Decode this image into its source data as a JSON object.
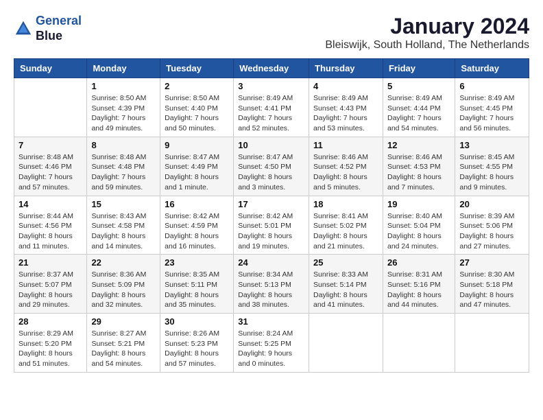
{
  "header": {
    "logo_line1": "General",
    "logo_line2": "Blue",
    "month": "January 2024",
    "location": "Bleiswijk, South Holland, The Netherlands"
  },
  "weekdays": [
    "Sunday",
    "Monday",
    "Tuesday",
    "Wednesday",
    "Thursday",
    "Friday",
    "Saturday"
  ],
  "weeks": [
    [
      {
        "day": "",
        "sunrise": "",
        "sunset": "",
        "daylight": ""
      },
      {
        "day": "1",
        "sunrise": "Sunrise: 8:50 AM",
        "sunset": "Sunset: 4:39 PM",
        "daylight": "Daylight: 7 hours and 49 minutes."
      },
      {
        "day": "2",
        "sunrise": "Sunrise: 8:50 AM",
        "sunset": "Sunset: 4:40 PM",
        "daylight": "Daylight: 7 hours and 50 minutes."
      },
      {
        "day": "3",
        "sunrise": "Sunrise: 8:49 AM",
        "sunset": "Sunset: 4:41 PM",
        "daylight": "Daylight: 7 hours and 52 minutes."
      },
      {
        "day": "4",
        "sunrise": "Sunrise: 8:49 AM",
        "sunset": "Sunset: 4:43 PM",
        "daylight": "Daylight: 7 hours and 53 minutes."
      },
      {
        "day": "5",
        "sunrise": "Sunrise: 8:49 AM",
        "sunset": "Sunset: 4:44 PM",
        "daylight": "Daylight: 7 hours and 54 minutes."
      },
      {
        "day": "6",
        "sunrise": "Sunrise: 8:49 AM",
        "sunset": "Sunset: 4:45 PM",
        "daylight": "Daylight: 7 hours and 56 minutes."
      }
    ],
    [
      {
        "day": "7",
        "sunrise": "Sunrise: 8:48 AM",
        "sunset": "Sunset: 4:46 PM",
        "daylight": "Daylight: 7 hours and 57 minutes."
      },
      {
        "day": "8",
        "sunrise": "Sunrise: 8:48 AM",
        "sunset": "Sunset: 4:48 PM",
        "daylight": "Daylight: 7 hours and 59 minutes."
      },
      {
        "day": "9",
        "sunrise": "Sunrise: 8:47 AM",
        "sunset": "Sunset: 4:49 PM",
        "daylight": "Daylight: 8 hours and 1 minute."
      },
      {
        "day": "10",
        "sunrise": "Sunrise: 8:47 AM",
        "sunset": "Sunset: 4:50 PM",
        "daylight": "Daylight: 8 hours and 3 minutes."
      },
      {
        "day": "11",
        "sunrise": "Sunrise: 8:46 AM",
        "sunset": "Sunset: 4:52 PM",
        "daylight": "Daylight: 8 hours and 5 minutes."
      },
      {
        "day": "12",
        "sunrise": "Sunrise: 8:46 AM",
        "sunset": "Sunset: 4:53 PM",
        "daylight": "Daylight: 8 hours and 7 minutes."
      },
      {
        "day": "13",
        "sunrise": "Sunrise: 8:45 AM",
        "sunset": "Sunset: 4:55 PM",
        "daylight": "Daylight: 8 hours and 9 minutes."
      }
    ],
    [
      {
        "day": "14",
        "sunrise": "Sunrise: 8:44 AM",
        "sunset": "Sunset: 4:56 PM",
        "daylight": "Daylight: 8 hours and 11 minutes."
      },
      {
        "day": "15",
        "sunrise": "Sunrise: 8:43 AM",
        "sunset": "Sunset: 4:58 PM",
        "daylight": "Daylight: 8 hours and 14 minutes."
      },
      {
        "day": "16",
        "sunrise": "Sunrise: 8:42 AM",
        "sunset": "Sunset: 4:59 PM",
        "daylight": "Daylight: 8 hours and 16 minutes."
      },
      {
        "day": "17",
        "sunrise": "Sunrise: 8:42 AM",
        "sunset": "Sunset: 5:01 PM",
        "daylight": "Daylight: 8 hours and 19 minutes."
      },
      {
        "day": "18",
        "sunrise": "Sunrise: 8:41 AM",
        "sunset": "Sunset: 5:02 PM",
        "daylight": "Daylight: 8 hours and 21 minutes."
      },
      {
        "day": "19",
        "sunrise": "Sunrise: 8:40 AM",
        "sunset": "Sunset: 5:04 PM",
        "daylight": "Daylight: 8 hours and 24 minutes."
      },
      {
        "day": "20",
        "sunrise": "Sunrise: 8:39 AM",
        "sunset": "Sunset: 5:06 PM",
        "daylight": "Daylight: 8 hours and 27 minutes."
      }
    ],
    [
      {
        "day": "21",
        "sunrise": "Sunrise: 8:37 AM",
        "sunset": "Sunset: 5:07 PM",
        "daylight": "Daylight: 8 hours and 29 minutes."
      },
      {
        "day": "22",
        "sunrise": "Sunrise: 8:36 AM",
        "sunset": "Sunset: 5:09 PM",
        "daylight": "Daylight: 8 hours and 32 minutes."
      },
      {
        "day": "23",
        "sunrise": "Sunrise: 8:35 AM",
        "sunset": "Sunset: 5:11 PM",
        "daylight": "Daylight: 8 hours and 35 minutes."
      },
      {
        "day": "24",
        "sunrise": "Sunrise: 8:34 AM",
        "sunset": "Sunset: 5:13 PM",
        "daylight": "Daylight: 8 hours and 38 minutes."
      },
      {
        "day": "25",
        "sunrise": "Sunrise: 8:33 AM",
        "sunset": "Sunset: 5:14 PM",
        "daylight": "Daylight: 8 hours and 41 minutes."
      },
      {
        "day": "26",
        "sunrise": "Sunrise: 8:31 AM",
        "sunset": "Sunset: 5:16 PM",
        "daylight": "Daylight: 8 hours and 44 minutes."
      },
      {
        "day": "27",
        "sunrise": "Sunrise: 8:30 AM",
        "sunset": "Sunset: 5:18 PM",
        "daylight": "Daylight: 8 hours and 47 minutes."
      }
    ],
    [
      {
        "day": "28",
        "sunrise": "Sunrise: 8:29 AM",
        "sunset": "Sunset: 5:20 PM",
        "daylight": "Daylight: 8 hours and 51 minutes."
      },
      {
        "day": "29",
        "sunrise": "Sunrise: 8:27 AM",
        "sunset": "Sunset: 5:21 PM",
        "daylight": "Daylight: 8 hours and 54 minutes."
      },
      {
        "day": "30",
        "sunrise": "Sunrise: 8:26 AM",
        "sunset": "Sunset: 5:23 PM",
        "daylight": "Daylight: 8 hours and 57 minutes."
      },
      {
        "day": "31",
        "sunrise": "Sunrise: 8:24 AM",
        "sunset": "Sunset: 5:25 PM",
        "daylight": "Daylight: 9 hours and 0 minutes."
      },
      {
        "day": "",
        "sunrise": "",
        "sunset": "",
        "daylight": ""
      },
      {
        "day": "",
        "sunrise": "",
        "sunset": "",
        "daylight": ""
      },
      {
        "day": "",
        "sunrise": "",
        "sunset": "",
        "daylight": ""
      }
    ]
  ]
}
